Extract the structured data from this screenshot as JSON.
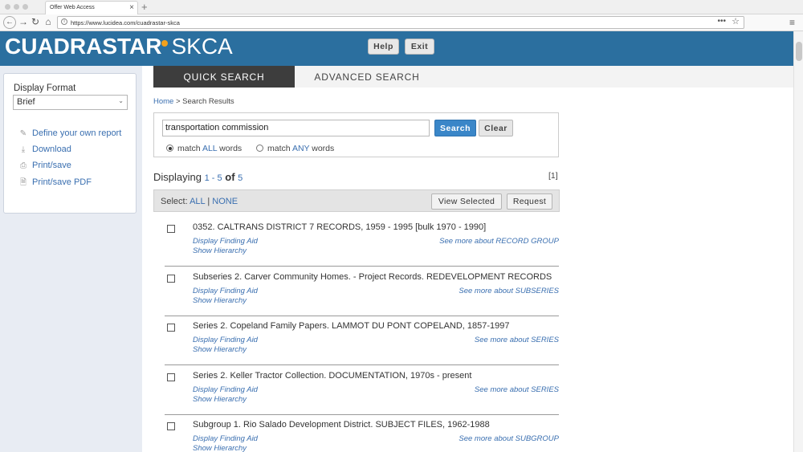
{
  "browser": {
    "tab_title": "Offer Web Access",
    "tab_close": "×",
    "new_tab": "+",
    "url": "https://www.lucidea.com/cuadrastar-skca",
    "more": "•••",
    "star": "☆",
    "menu": "≡"
  },
  "header": {
    "logo_main": "CUADRASTAR",
    "logo_sub": "SKCA",
    "help_label": "Help",
    "exit_label": "Exit",
    "accent_color": "#2b6f9f"
  },
  "sidebar": {
    "display_format_label": "Display Format",
    "display_format_value": "Brief",
    "links": [
      {
        "label": "Define your own report",
        "icon": "pencil-icon"
      },
      {
        "label": "Download",
        "icon": "download-icon"
      },
      {
        "label": "Print/save",
        "icon": "printer-icon"
      },
      {
        "label": "Print/save PDF",
        "icon": "pdf-icon"
      }
    ]
  },
  "tabs": [
    {
      "label": "QUICK SEARCH",
      "active": true
    },
    {
      "label": "ADVANCED SEARCH",
      "active": false
    }
  ],
  "breadcrumb": {
    "home": "Home",
    "sep": " > ",
    "current": "Search Results"
  },
  "search": {
    "query": "transportation commission",
    "search_label": "Search",
    "clear_label": "Clear",
    "match_all_pre": "match ",
    "match_all_hl": "ALL",
    "match_all_post": " words",
    "match_any_pre": "match ",
    "match_any_hl": "ANY",
    "match_any_post": " words",
    "selected": "all"
  },
  "results_summary": {
    "displaying": "Displaying",
    "range_start": "1",
    "range_sep": " - ",
    "range_end": "5",
    "of": "of",
    "total": "5",
    "page": "[1]"
  },
  "selection_bar": {
    "select_label": "Select:",
    "all": "ALL",
    "sep": " | ",
    "none": "NONE",
    "view_selected": "View Selected",
    "request": "Request"
  },
  "results": [
    {
      "title": "0352. CALTRANS DISTRICT 7 RECORDS, 1959 - 1995 [bulk 1970 - 1990]",
      "finding_aid": "Display Finding Aid",
      "hierarchy": "Show Hierarchy",
      "more": "See more about RECORD GROUP"
    },
    {
      "title": "Subseries 2. Carver Community Homes. - Project Records. REDEVELOPMENT RECORDS",
      "finding_aid": "Display Finding Aid",
      "hierarchy": "Show Hierarchy",
      "more": "See more about SUBSERIES"
    },
    {
      "title": "Series 2. Copeland Family Papers. LAMMOT DU PONT COPELAND, 1857-1997",
      "finding_aid": "Display Finding Aid",
      "hierarchy": "Show Hierarchy",
      "more": "See more about SERIES"
    },
    {
      "title": "Series 2. Keller Tractor Collection. DOCUMENTATION, 1970s - present",
      "finding_aid": "Display Finding Aid",
      "hierarchy": "Show Hierarchy",
      "more": "See more about SERIES"
    },
    {
      "title": "Subgroup 1. Rio Salado Development District. SUBJECT FILES, 1962-1988",
      "finding_aid": "Display Finding Aid",
      "hierarchy": "Show Hierarchy",
      "more": "See more about SUBGROUP"
    }
  ]
}
